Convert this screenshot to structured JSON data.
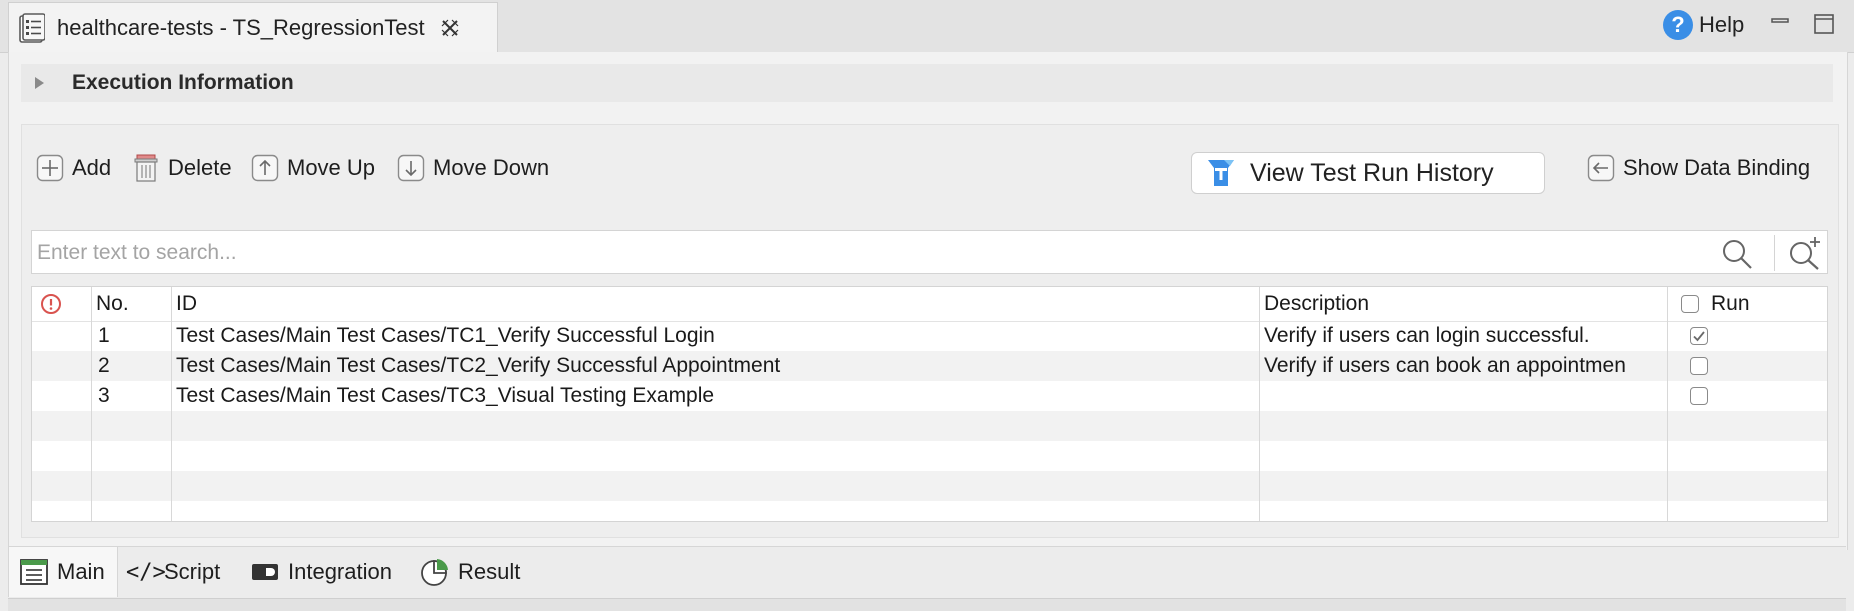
{
  "editor": {
    "tab_title": "healthcare-tests - TS_RegressionTest",
    "help_label": "Help"
  },
  "execution": {
    "title": "Execution Information"
  },
  "toolbar": {
    "add_label": "Add",
    "delete_label": "Delete",
    "move_up_label": "Move Up",
    "move_down_label": "Move Down",
    "history_label": "View Test Run History",
    "show_binding_label": "Show Data Binding"
  },
  "search": {
    "placeholder": "Enter text to search..."
  },
  "table": {
    "columns": {
      "no": "No.",
      "id": "ID",
      "description": "Description",
      "run": "Run"
    },
    "rows": [
      {
        "no": "1",
        "id": "Test Cases/Main Test Cases/TC1_Verify Successful Login",
        "description": "Verify if users can login successful.",
        "run": true
      },
      {
        "no": "2",
        "id": "Test Cases/Main Test Cases/TC2_Verify Successful Appointment",
        "description": "Verify if users can book an appointmen",
        "run": false
      },
      {
        "no": "3",
        "id": "Test Cases/Main Test Cases/TC3_Visual Testing Example",
        "description": "",
        "run": false
      }
    ]
  },
  "bottom_tabs": {
    "main": "Main",
    "script": "Script",
    "integration": "Integration",
    "result": "Result",
    "script_glyph": "</>"
  },
  "colors": {
    "accent_blue": "#3a8ee6",
    "error_red": "#d9534f"
  }
}
